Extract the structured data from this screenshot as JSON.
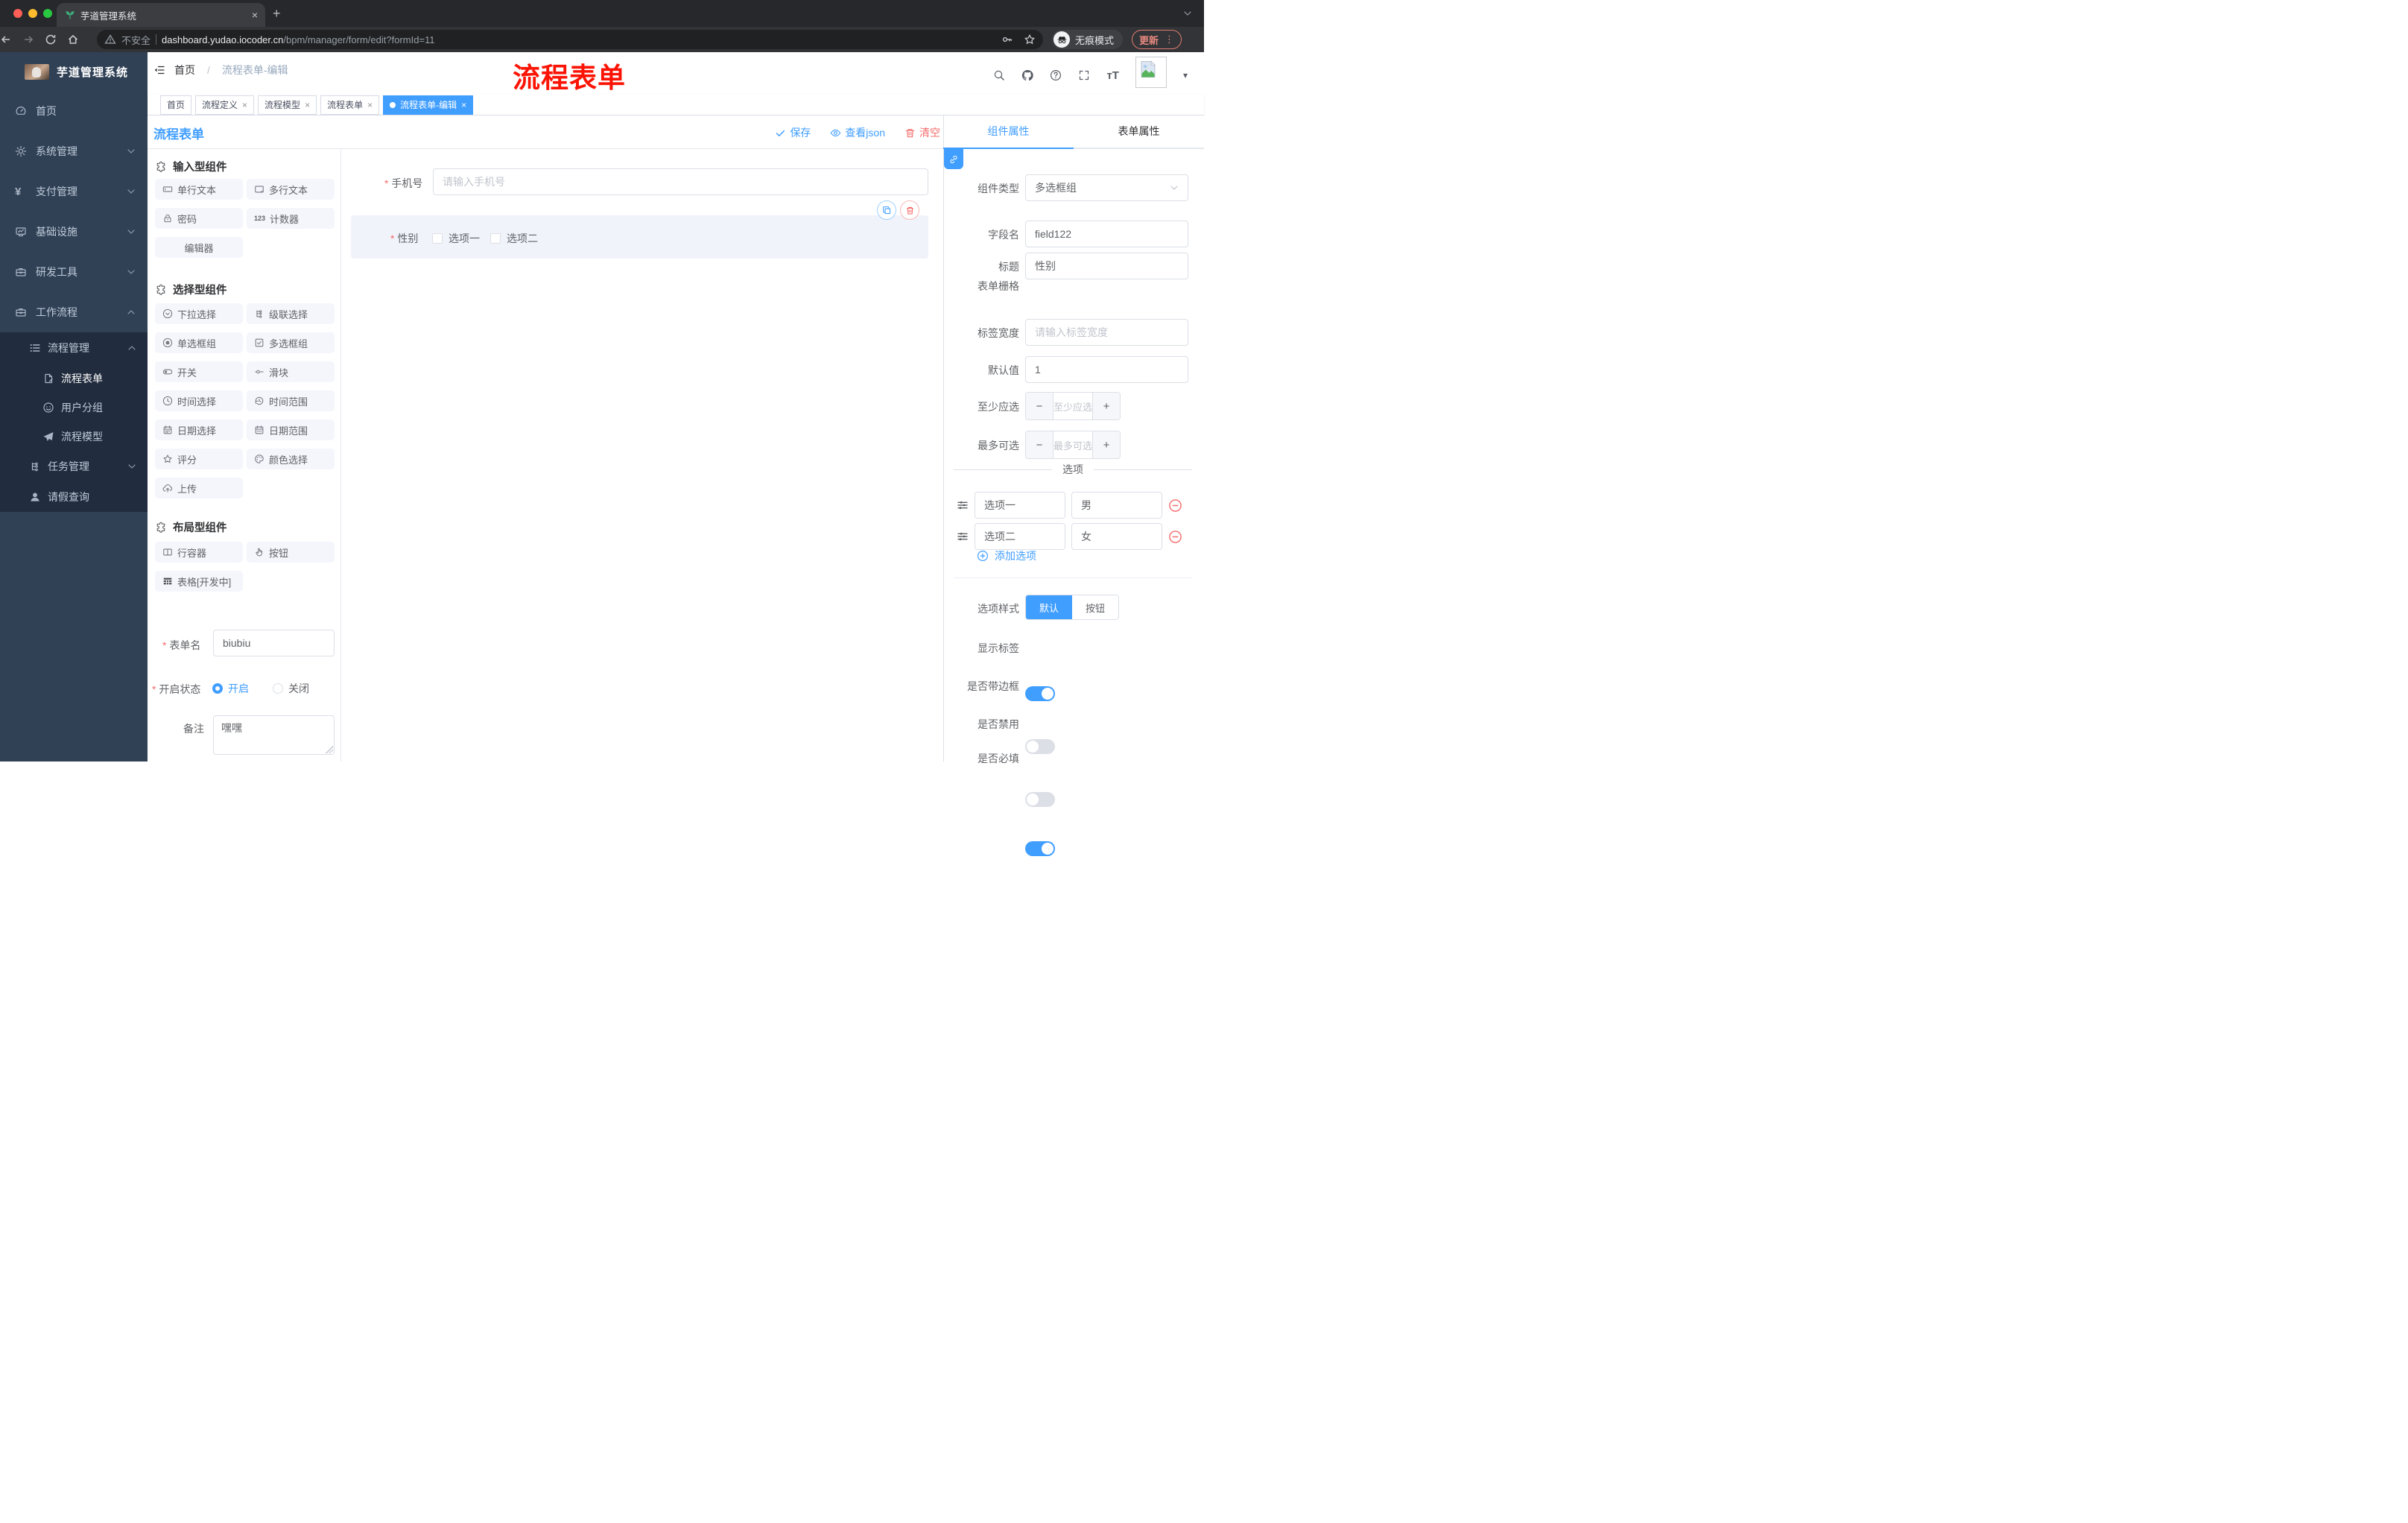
{
  "browser": {
    "tab_title": "芋道管理系统",
    "close_tab": "×",
    "new_tab": "+",
    "security_label": "不安全",
    "url_host": "dashboard.yudao.iocoder.cn",
    "url_path": "/bpm/manager/form/edit?formId=11",
    "incognito_label": "无痕模式",
    "update_label": "更新"
  },
  "annotation": {
    "text": "流程表单",
    "color": "#fb1405"
  },
  "sidebar": {
    "logo_title": "芋道管理系统",
    "items": [
      {
        "label": "首页",
        "icon": "dashboard"
      },
      {
        "label": "系统管理",
        "icon": "gear"
      },
      {
        "label": "支付管理",
        "icon": "yen"
      },
      {
        "label": "基础设施",
        "icon": "monitor"
      },
      {
        "label": "研发工具",
        "icon": "toolbox"
      },
      {
        "label": "工作流程",
        "icon": "briefcase"
      }
    ],
    "submenu": {
      "group_label": "流程管理",
      "children": [
        {
          "label": "流程表单",
          "icon": "doc"
        },
        {
          "label": "用户分组",
          "icon": "face"
        },
        {
          "label": "流程模型",
          "icon": "plane"
        }
      ],
      "task_label": "任务管理",
      "leave_label": "请假查询"
    }
  },
  "breadcrumb": {
    "home": "首页",
    "sep": "/",
    "current": "流程表单-编辑"
  },
  "tags": [
    {
      "label": "首页",
      "closable": false,
      "active": false
    },
    {
      "label": "流程定义",
      "closable": true,
      "active": false
    },
    {
      "label": "流程模型",
      "closable": true,
      "active": false
    },
    {
      "label": "流程表单",
      "closable": true,
      "active": false
    },
    {
      "label": "流程表单-编辑",
      "closable": true,
      "active": true
    }
  ],
  "toolbar": {
    "title": "流程表单",
    "save": "保存",
    "view_json": "查看json",
    "clear": "清空"
  },
  "palette": {
    "sections": [
      {
        "title": "输入型组件",
        "items": [
          {
            "label": "单行文本",
            "icon": "inputbox"
          },
          {
            "label": "多行文本",
            "icon": "textarea"
          },
          {
            "label": "密码",
            "icon": "lock"
          },
          {
            "label": "计数器",
            "icon": "counter",
            "counter_text": "123"
          },
          {
            "label": "编辑器",
            "icon": "none"
          }
        ]
      },
      {
        "title": "选择型组件",
        "items": [
          {
            "label": "下拉选择",
            "icon": "selecticon"
          },
          {
            "label": "级联选择",
            "icon": "cascader"
          },
          {
            "label": "单选框组",
            "icon": "radioicon"
          },
          {
            "label": "多选框组",
            "icon": "checkboxicon"
          },
          {
            "label": "开关",
            "icon": "switchicon"
          },
          {
            "label": "滑块",
            "icon": "slidericon"
          },
          {
            "label": "时间选择",
            "icon": "time"
          },
          {
            "label": "时间范围",
            "icon": "timerange"
          },
          {
            "label": "日期选择",
            "icon": "date"
          },
          {
            "label": "日期范围",
            "icon": "daterange"
          },
          {
            "label": "评分",
            "icon": "star"
          },
          {
            "label": "颜色选择",
            "icon": "colorsel"
          },
          {
            "label": "上传",
            "icon": "upload"
          }
        ]
      },
      {
        "title": "布局型组件",
        "items": [
          {
            "label": "行容器",
            "icon": "rowcol"
          },
          {
            "label": "按钮",
            "icon": "handbtn"
          },
          {
            "label": "表格[开发中]",
            "icon": "tablegrid"
          }
        ]
      }
    ]
  },
  "meta_form": {
    "name_label": "表单名",
    "name_value": "biubiu",
    "status_label": "开启状态",
    "status_on": "开启",
    "status_off": "关闭",
    "remark_label": "备注",
    "remark_value": "嘿嘿"
  },
  "canvas": {
    "phone": {
      "label": "手机号",
      "placeholder": "请输入手机号"
    },
    "gender": {
      "label": "性别",
      "option1": "选项一",
      "option2": "选项二"
    }
  },
  "panel": {
    "tab_component": "组件属性",
    "tab_form": "表单属性",
    "type_label": "组件类型",
    "type_value": "多选框组",
    "field_label": "字段名",
    "field_value": "field122",
    "title_label": "标题",
    "title_value": "性别",
    "grid_label": "表单栅格",
    "labelwidth_label": "标签宽度",
    "labelwidth_placeholder": "请输入标签宽度",
    "default_label": "默认值",
    "default_value": "1",
    "min_label": "至少应选",
    "min_placeholder": "至少应选",
    "max_label": "最多可选",
    "max_placeholder": "最多可选",
    "options_title": "选项",
    "options": [
      {
        "label": "选项一",
        "value": "男"
      },
      {
        "label": "选项二",
        "value": "女"
      }
    ],
    "add_option": "添加选项",
    "style_label": "选项样式",
    "style_default": "默认",
    "style_button": "按钮",
    "switch_show_label": "显示标签",
    "switch_border": "是否带边框",
    "switch_disabled": "是否禁用",
    "switch_required": "是否必填"
  },
  "colors": {
    "accent": "#409eff",
    "danger": "#f56c6c",
    "sidebar": "#304156",
    "submenu": "#212d3e"
  }
}
